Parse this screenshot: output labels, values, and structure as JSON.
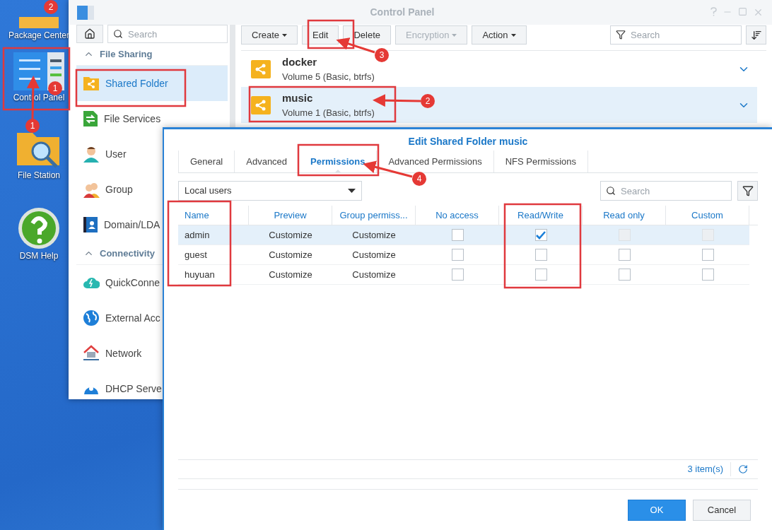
{
  "desktop": {
    "icons": [
      {
        "label": "Package Center"
      },
      {
        "label": "Control Panel"
      },
      {
        "label": "File Station"
      },
      {
        "label": "DSM Help"
      }
    ]
  },
  "control_panel": {
    "title": "Control Panel",
    "search": {
      "placeholder": "Search"
    },
    "sidebar": [
      {
        "title": "File Sharing",
        "expanded": true,
        "items": [
          {
            "label": "Shared Folder",
            "selected": true
          },
          {
            "label": "File Services",
            "selected": false
          },
          {
            "label": "User",
            "selected": false
          },
          {
            "label": "Group",
            "selected": false
          },
          {
            "label": "Domain/LDA",
            "selected": false
          }
        ]
      },
      {
        "title": "Connectivity",
        "expanded": true,
        "items": [
          {
            "label": "QuickConne",
            "selected": false
          },
          {
            "label": "External Acc",
            "selected": false
          },
          {
            "label": "Network",
            "selected": false
          },
          {
            "label": "DHCP Serve",
            "selected": false
          }
        ]
      }
    ],
    "toolbar": [
      {
        "label": "Create",
        "menu": true,
        "disabled": false
      },
      {
        "label": "Edit",
        "menu": false,
        "disabled": false
      },
      {
        "label": "Delete",
        "menu": false,
        "disabled": false
      },
      {
        "label": "Encryption",
        "menu": true,
        "disabled": true
      },
      {
        "label": "Action",
        "menu": true,
        "disabled": false
      }
    ],
    "filter_search": {
      "placeholder": "Search"
    },
    "folders": [
      {
        "name": "docker",
        "description": "Volume 5 (Basic, btrfs)",
        "selected": false
      },
      {
        "name": "music",
        "description": "Volume 1 (Basic, btrfs)",
        "selected": true
      }
    ]
  },
  "dialog": {
    "title": "Edit Shared Folder music",
    "tabs": [
      {
        "label": "General",
        "selected": false
      },
      {
        "label": "Advanced",
        "selected": false
      },
      {
        "label": "Permissions",
        "selected": true
      },
      {
        "label": "Advanced Permissions",
        "selected": false
      },
      {
        "label": "NFS Permissions",
        "selected": false
      }
    ],
    "user_type": "Local users",
    "search": {
      "placeholder": "Search"
    },
    "columns": [
      "Name",
      "Preview",
      "Group permiss...",
      "No access",
      "Read/Write",
      "Read only",
      "Custom"
    ],
    "rows": [
      {
        "name": "admin",
        "preview": "Customize",
        "group": "Customize",
        "selected": true,
        "permissions": [
          {
            "checked": false,
            "disabled": false
          },
          {
            "checked": true,
            "disabled": false
          },
          {
            "checked": false,
            "disabled": true
          },
          {
            "checked": false,
            "disabled": true
          }
        ]
      },
      {
        "name": "guest",
        "preview": "Customize",
        "group": "Customize",
        "selected": false,
        "permissions": [
          {
            "checked": false,
            "disabled": false
          },
          {
            "checked": false,
            "disabled": false
          },
          {
            "checked": false,
            "disabled": false
          },
          {
            "checked": false,
            "disabled": false
          }
        ]
      },
      {
        "name": "huyuan",
        "preview": "Customize",
        "group": "Customize",
        "selected": false,
        "permissions": [
          {
            "checked": false,
            "disabled": false
          },
          {
            "checked": false,
            "disabled": false
          },
          {
            "checked": false,
            "disabled": false
          },
          {
            "checked": false,
            "disabled": false
          }
        ]
      }
    ],
    "item_count": "3 item(s)",
    "buttons": [
      {
        "label": "OK",
        "kind": "primary"
      },
      {
        "label": "Cancel",
        "kind": "secondary"
      }
    ]
  },
  "annotations": [
    {
      "label": "2"
    },
    {
      "label": "1"
    },
    {
      "label": "1"
    },
    {
      "label": "3"
    },
    {
      "label": "2"
    },
    {
      "label": "4"
    }
  ]
}
